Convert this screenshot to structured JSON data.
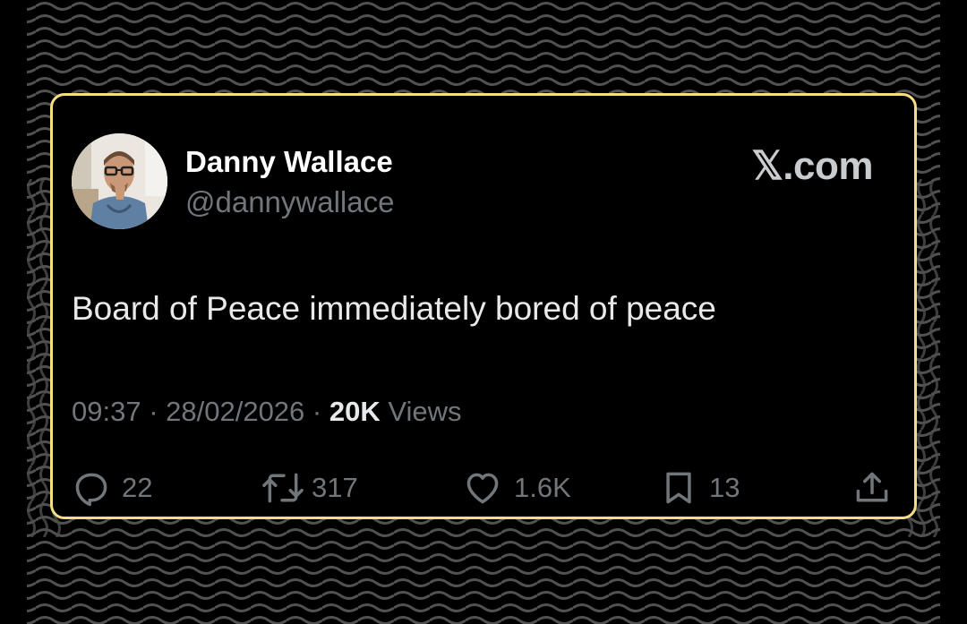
{
  "tweet": {
    "display_name": "Danny Wallace",
    "handle": "@dannywallace",
    "brand": "𝕏.com",
    "text": "Board of Peace immediately bored of peace",
    "time": "09:37",
    "date": "28/02/2026",
    "views_count": "20K",
    "views_label": "Views",
    "separator": " · "
  },
  "actions": {
    "replies": "22",
    "reposts": "317",
    "likes": "1.6K",
    "bookmarks": "13"
  },
  "colors": {
    "card_border": "#f5dd86",
    "background": "#000000",
    "primary_text": "#e7e9ea",
    "secondary_text": "#71767b"
  },
  "icons": [
    "reply-icon",
    "repost-icon",
    "like-icon",
    "bookmark-icon",
    "share-icon"
  ]
}
